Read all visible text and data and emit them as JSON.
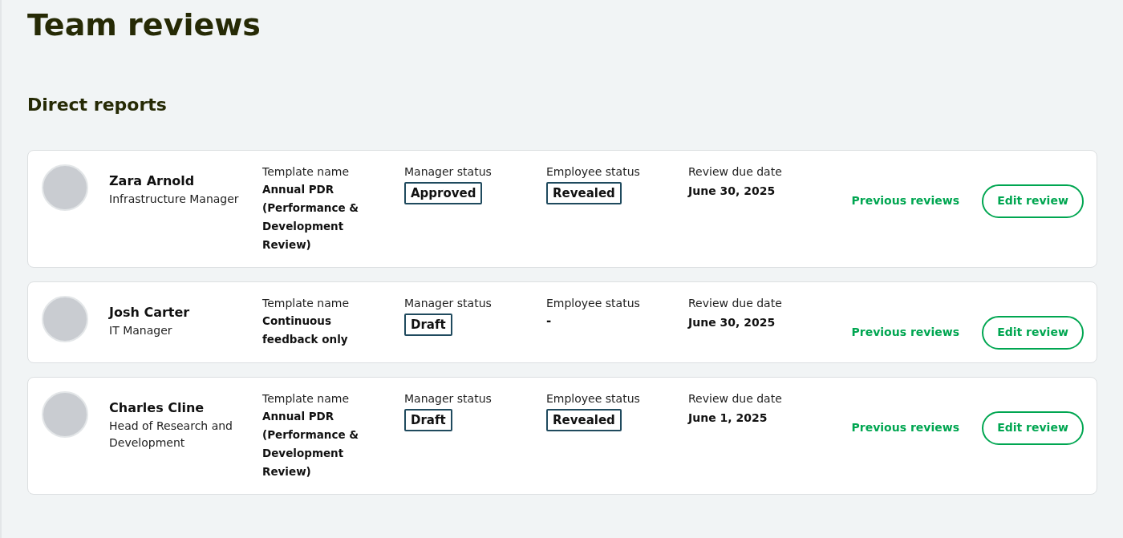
{
  "page": {
    "title": "Team reviews",
    "section": "Direct reports"
  },
  "reports": [
    {
      "name": "Zara Arnold",
      "role": "Infrastructure Manager",
      "template_label": "Template name",
      "template": "Annual PDR (Performance & Development Review)",
      "manager_label": "Manager status",
      "manager_status": {
        "kind": "badge",
        "text": "Approved"
      },
      "employee_label": "Employee status",
      "employee_status": {
        "kind": "badge",
        "text": "Revealed"
      },
      "due_label": "Review due date",
      "due": "June 30, 2025",
      "link": "Previous reviews",
      "button": "Edit review"
    },
    {
      "name": "Josh Carter",
      "role": "IT Manager",
      "template_label": "Template name",
      "template": "Continuous feedback only",
      "manager_label": "Manager status",
      "manager_status": {
        "kind": "badge",
        "text": "Draft"
      },
      "employee_label": "Employee status",
      "employee_status": {
        "kind": "text",
        "text": "-"
      },
      "due_label": "Review due date",
      "due": "June 30, 2025",
      "link": "Previous reviews",
      "button": "Edit review"
    },
    {
      "name": "Charles Cline",
      "role": "Head of Research and Development",
      "template_label": "Template name",
      "template": "Annual PDR (Performance & Development Review)",
      "manager_label": "Manager status",
      "manager_status": {
        "kind": "badge",
        "text": "Draft"
      },
      "employee_label": "Employee status",
      "employee_status": {
        "kind": "badge",
        "text": "Revealed"
      },
      "due_label": "Review due date",
      "due": "June 1, 2025",
      "link": "Previous reviews",
      "button": "Edit review"
    }
  ]
}
